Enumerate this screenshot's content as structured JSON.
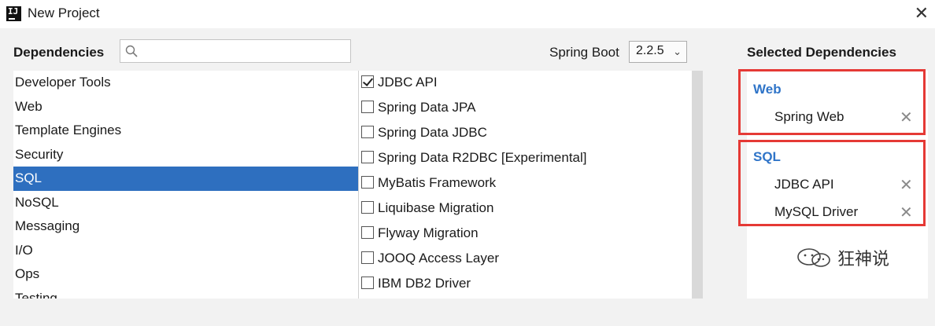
{
  "window": {
    "title": "New Project"
  },
  "header": {
    "dependencies_label": "Dependencies",
    "search_placeholder": "",
    "spring_boot_label": "Spring Boot",
    "spring_boot_version": "2.2.5",
    "selected_label": "Selected Dependencies"
  },
  "categories": [
    {
      "label": "Developer Tools",
      "selected": false
    },
    {
      "label": "Web",
      "selected": false
    },
    {
      "label": "Template Engines",
      "selected": false
    },
    {
      "label": "Security",
      "selected": false
    },
    {
      "label": "SQL",
      "selected": true
    },
    {
      "label": "NoSQL",
      "selected": false
    },
    {
      "label": "Messaging",
      "selected": false
    },
    {
      "label": "I/O",
      "selected": false
    },
    {
      "label": "Ops",
      "selected": false
    },
    {
      "label": "Testing",
      "selected": false
    }
  ],
  "dependencies": [
    {
      "label": "JDBC API",
      "checked": true
    },
    {
      "label": "Spring Data JPA",
      "checked": false
    },
    {
      "label": "Spring Data JDBC",
      "checked": false
    },
    {
      "label": "Spring Data R2DBC [Experimental]",
      "checked": false
    },
    {
      "label": "MyBatis Framework",
      "checked": false
    },
    {
      "label": "Liquibase Migration",
      "checked": false
    },
    {
      "label": "Flyway Migration",
      "checked": false
    },
    {
      "label": "JOOQ Access Layer",
      "checked": false
    },
    {
      "label": "IBM DB2 Driver",
      "checked": false
    }
  ],
  "selected_groups": [
    {
      "title": "Web",
      "items": [
        "Spring Web"
      ]
    },
    {
      "title": "SQL",
      "items": [
        "JDBC API",
        "MySQL Driver"
      ]
    }
  ],
  "remove_glyph": "✕",
  "watermark": {
    "text": "狂神说"
  },
  "colors": {
    "selection": "#2e6fbf",
    "group_title": "#2f74c8",
    "highlight_box": "#e53935"
  }
}
